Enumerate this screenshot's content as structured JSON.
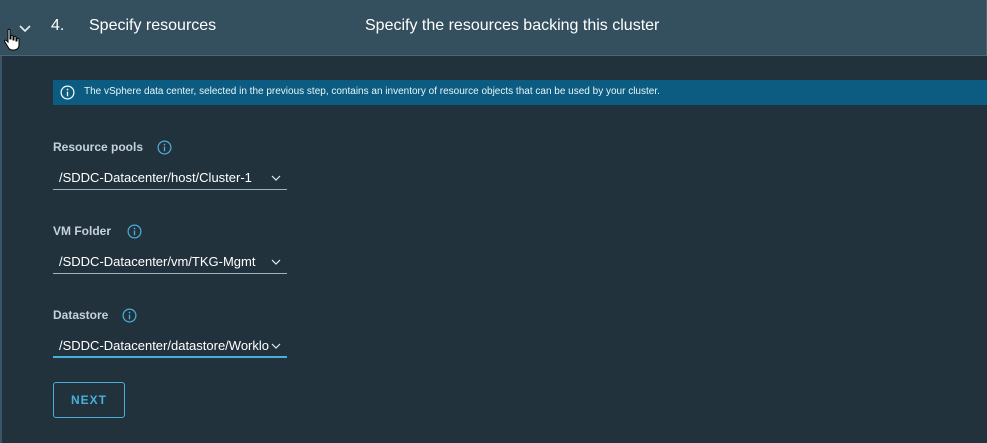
{
  "step": {
    "number": "4.",
    "title": "Specify resources",
    "description": "Specify the resources backing this cluster"
  },
  "banner": {
    "text": "The vSphere data center, selected in the previous step, contains an inventory of resource objects that can be used by your cluster.",
    "icon": "info-circle-icon"
  },
  "fields": {
    "resource_pools": {
      "label": "Resource pools",
      "value": "/SDDC-Datacenter/host/Cluster-1"
    },
    "vm_folder": {
      "label": "VM Folder",
      "value": "/SDDC-Datacenter/vm/TKG-Mgmt"
    },
    "datastore": {
      "label": "Datastore",
      "value": "/SDDC-Datacenter/datastore/WorkloadDatastore"
    }
  },
  "actions": {
    "next_label": "NEXT"
  },
  "colors": {
    "header_bg": "#34505f",
    "page_bg": "#22323d",
    "banner_bg": "#0b5c80",
    "accent": "#49afd9"
  }
}
